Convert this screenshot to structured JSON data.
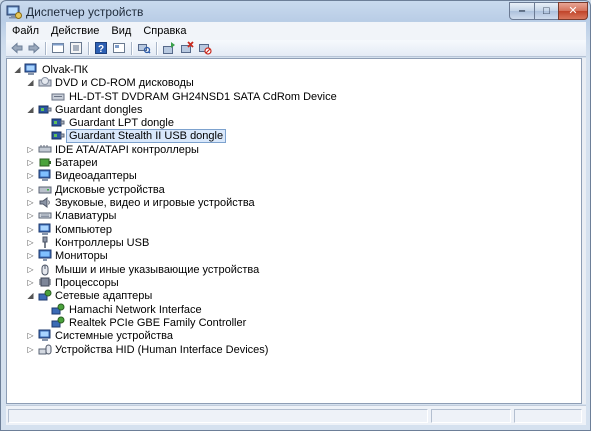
{
  "window": {
    "title": "Диспетчер устройств",
    "controls": {
      "minimize": "‒",
      "maximize": "□",
      "close": "✕"
    }
  },
  "menu": [
    "Файл",
    "Действие",
    "Вид",
    "Справка"
  ],
  "toolbar": [
    "back-icon",
    "forward-icon",
    "properties-icon",
    "view-icon",
    "help-icon",
    "show-hidden-icon",
    "scan-hardware-icon",
    "update-driver-icon",
    "uninstall-icon",
    "disable-icon"
  ],
  "tree": {
    "root": "Olvak-ПК",
    "items": [
      {
        "label": "DVD и CD-ROM дисководы",
        "expanded": true,
        "icon": "dvd-drive-icon"
      },
      {
        "label": "HL-DT-ST DVDRAM GH24NSD1 SATA CdRom Device",
        "icon": "dvd-device-icon"
      },
      {
        "label": "Guardant dongles",
        "expanded": true,
        "icon": "dongle-category-icon"
      },
      {
        "label": "Guardant LPT dongle",
        "icon": "dongle-icon"
      },
      {
        "label": "Guardant Stealth II USB dongle",
        "icon": "dongle-icon",
        "selected": true
      },
      {
        "label": "IDE ATA/ATAPI контроллеры",
        "icon": "ide-controller-icon"
      },
      {
        "label": "Батареи",
        "icon": "battery-icon"
      },
      {
        "label": "Видеоадаптеры",
        "icon": "display-adapter-icon"
      },
      {
        "label": "Дисковые устройства",
        "icon": "disk-drive-icon"
      },
      {
        "label": "Звуковые, видео и игровые устройства",
        "icon": "sound-icon"
      },
      {
        "label": "Клавиатуры",
        "icon": "keyboard-icon"
      },
      {
        "label": "Компьютер",
        "icon": "computer-icon"
      },
      {
        "label": "Контроллеры USB",
        "icon": "usb-icon"
      },
      {
        "label": "Мониторы",
        "icon": "monitor-icon"
      },
      {
        "label": "Мыши и иные указывающие устройства",
        "icon": "mouse-icon"
      },
      {
        "label": "Процессоры",
        "icon": "processor-icon"
      },
      {
        "label": "Сетевые адаптеры",
        "expanded": true,
        "icon": "network-adapter-icon"
      },
      {
        "label": "Hamachi Network Interface",
        "icon": "network-device-icon"
      },
      {
        "label": "Realtek PCIe GBE Family Controller",
        "icon": "network-device-icon"
      },
      {
        "label": "Системные устройства",
        "icon": "system-device-icon"
      },
      {
        "label": "Устройства HID (Human Interface Devices)",
        "icon": "hid-icon"
      }
    ]
  },
  "colors": {
    "selection_bg": "#d9e8fb",
    "selection_border": "#7da2ce",
    "titlebar": "#b9cde6"
  }
}
